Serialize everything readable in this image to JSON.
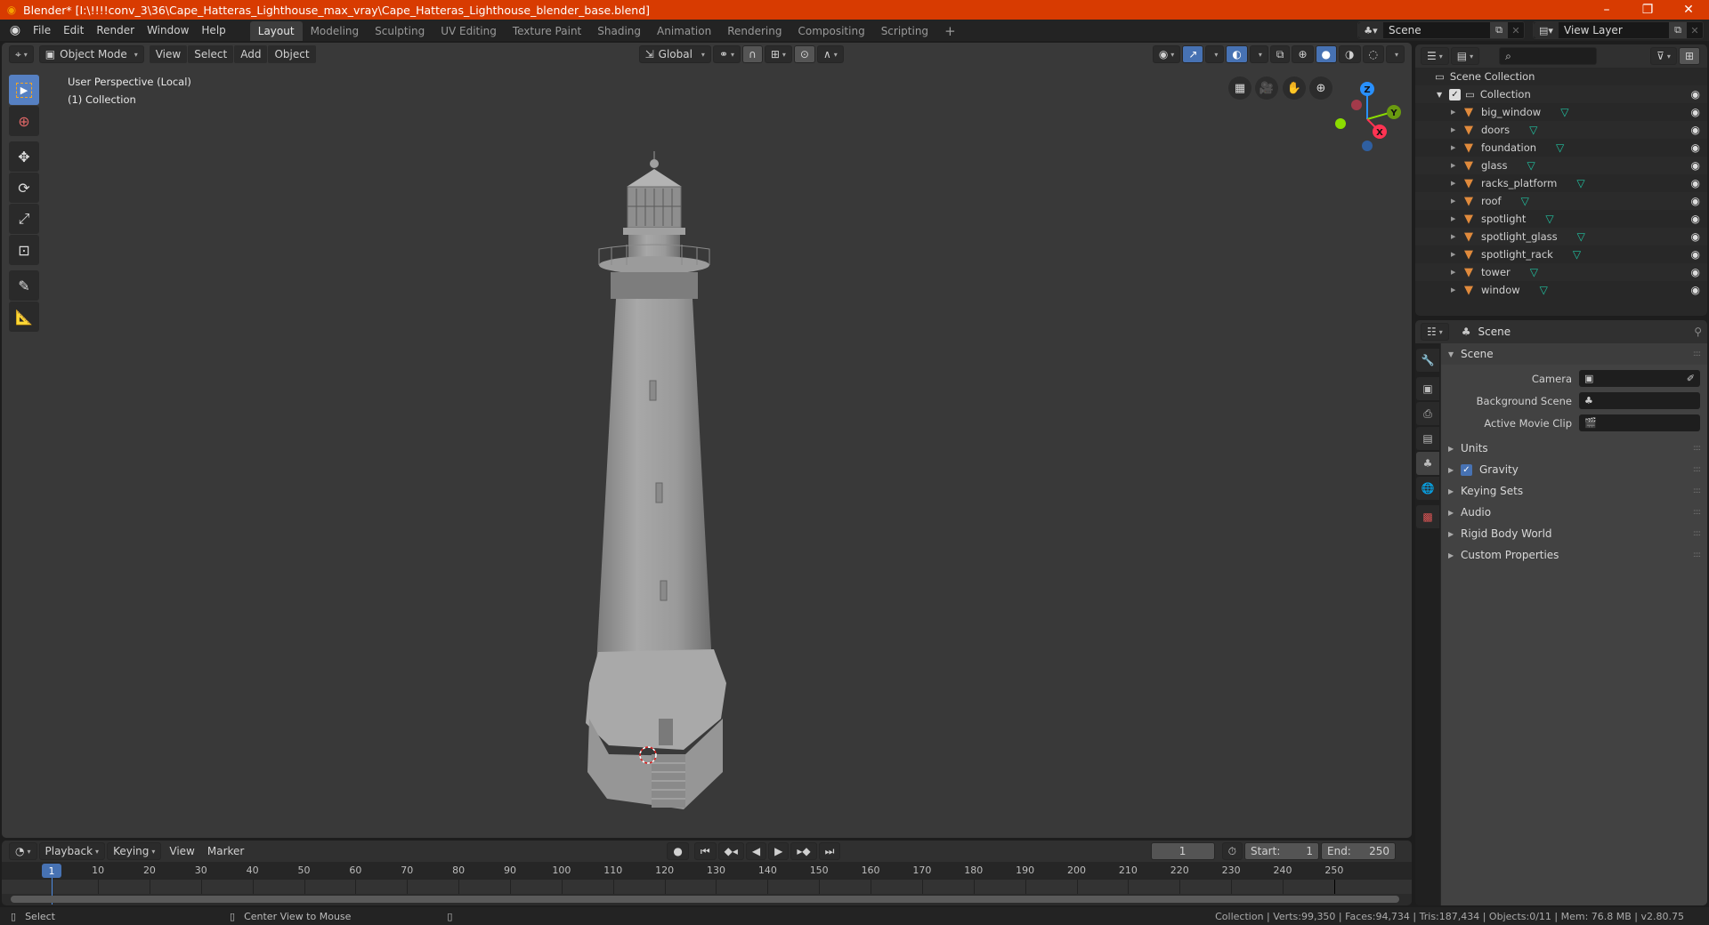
{
  "window": {
    "title": "Blender* [I:\\!!!!conv_3\\36\\Cape_Hatteras_Lighthouse_max_vray\\Cape_Hatteras_Lighthouse_blender_base.blend]",
    "controls": {
      "minimize": "–",
      "maximize": "❐",
      "close": "✕"
    }
  },
  "topbar": {
    "menus": [
      "File",
      "Edit",
      "Render",
      "Window",
      "Help"
    ],
    "workspaces": [
      "Layout",
      "Modeling",
      "Sculpting",
      "UV Editing",
      "Texture Paint",
      "Shading",
      "Animation",
      "Rendering",
      "Compositing",
      "Scripting"
    ],
    "active_workspace": "Layout",
    "add_workspace": "+",
    "scene": "Scene",
    "view_layer": "View Layer"
  },
  "viewport": {
    "header": {
      "mode": "Object Mode",
      "menus": [
        "View",
        "Select",
        "Add",
        "Object"
      ],
      "orientation": "Global"
    },
    "overlay_text": {
      "line1": "User Perspective (Local)",
      "line2": "(1) Collection"
    },
    "tools": [
      "select-box",
      "cursor",
      "move",
      "rotate",
      "scale",
      "transform",
      "annotate",
      "measure"
    ],
    "nav_buttons": [
      "toggle-grid",
      "camera-view",
      "pan",
      "zoom"
    ],
    "gizmo": {
      "x": "X",
      "y": "Y",
      "z": "Z",
      "colors": {
        "x": "#ff3352",
        "y": "#8bdc00",
        "z": "#2890ff"
      }
    }
  },
  "outliner": {
    "root": "Scene Collection",
    "collection": "Collection",
    "objects": [
      "big_window",
      "doors",
      "foundation",
      "glass",
      "racks_platform",
      "roof",
      "spotlight",
      "spotlight_glass",
      "spotlight_rack",
      "tower",
      "window"
    ]
  },
  "properties": {
    "context": "Scene",
    "panel_scene": {
      "title": "Scene",
      "fields": [
        {
          "label": "Camera",
          "value": ""
        },
        {
          "label": "Background Scene",
          "value": ""
        },
        {
          "label": "Active Movie Clip",
          "value": ""
        }
      ]
    },
    "panels": [
      {
        "title": "Units",
        "checkbox": false
      },
      {
        "title": "Gravity",
        "checkbox": true
      },
      {
        "title": "Keying Sets",
        "checkbox": false
      },
      {
        "title": "Audio",
        "checkbox": false
      },
      {
        "title": "Rigid Body World",
        "checkbox": false
      },
      {
        "title": "Custom Properties",
        "checkbox": false
      }
    ]
  },
  "timeline": {
    "menus": [
      "Playback",
      "Keying",
      "View",
      "Marker"
    ],
    "current_frame": "1",
    "start_label": "Start:",
    "start": "1",
    "end_label": "End:",
    "end": "250",
    "ruler_ticks": [
      "1",
      "10",
      "20",
      "30",
      "40",
      "50",
      "60",
      "70",
      "80",
      "90",
      "100",
      "110",
      "120",
      "130",
      "140",
      "150",
      "160",
      "170",
      "180",
      "190",
      "200",
      "210",
      "220",
      "230",
      "240",
      "250"
    ]
  },
  "statusbar": {
    "left_hint": "Select",
    "middle_hint": "Center View to Mouse",
    "stats": "Collection | Verts:99,350 | Faces:94,734 | Tris:187,434 | Objects:0/11 | Mem: 76.8 MB | v2.80.75"
  }
}
